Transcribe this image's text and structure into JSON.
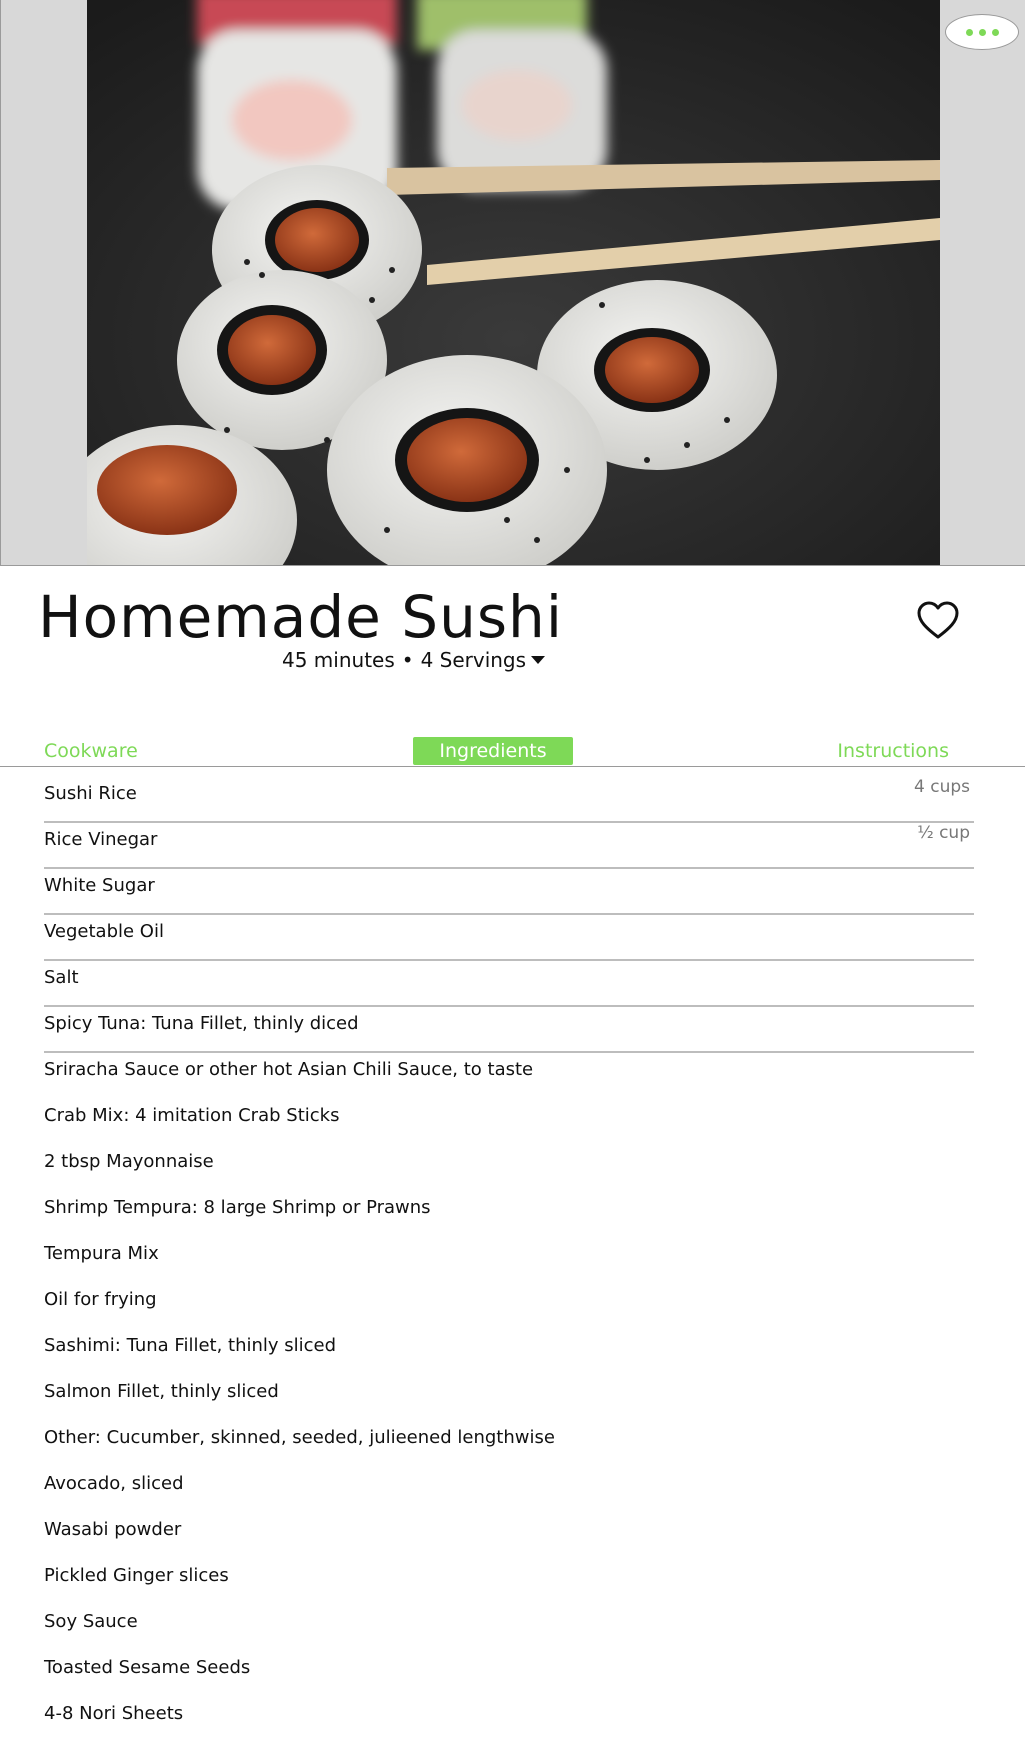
{
  "recipe": {
    "title": "Homemade Sushi",
    "time": "45 minutes",
    "separator": "•",
    "servings": "4 Servings"
  },
  "icons": {
    "more": "more-dots-icon",
    "favorite": "heart-outline-icon",
    "dropdown": "caret-down-icon"
  },
  "colors": {
    "accent": "#7ed957",
    "text": "#111111",
    "muted": "#777777",
    "rule": "#bdbdbd"
  },
  "tabs": [
    {
      "label": "Cookware",
      "active": false
    },
    {
      "label": "Ingredients",
      "active": true
    },
    {
      "label": "Instructions",
      "active": false
    }
  ],
  "ingredients": [
    {
      "name": "Sushi Rice",
      "qty": "4 cups",
      "divider": true
    },
    {
      "name": "Rice Vinegar",
      "qty": "½ cup",
      "divider": true
    },
    {
      "name": "White Sugar",
      "qty": "",
      "divider": true
    },
    {
      "name": "Vegetable Oil",
      "qty": "",
      "divider": true
    },
    {
      "name": "Salt",
      "qty": "",
      "divider": true
    },
    {
      "name": "Spicy Tuna: Tuna Fillet, thinly diced",
      "qty": "",
      "divider": true
    },
    {
      "name": "Sriracha Sauce or other hot Asian Chili Sauce, to taste",
      "qty": "",
      "divider": false
    },
    {
      "name": "Crab Mix: 4 imitation Crab Sticks",
      "qty": "",
      "divider": false
    },
    {
      "name": "2 tbsp Mayonnaise",
      "qty": "",
      "divider": false
    },
    {
      "name": "Shrimp Tempura: 8 large Shrimp or Prawns",
      "qty": "",
      "divider": false
    },
    {
      "name": "Tempura Mix",
      "qty": "",
      "divider": false
    },
    {
      "name": "Oil for frying",
      "qty": "",
      "divider": false
    },
    {
      "name": "Sashimi: Tuna Fillet, thinly sliced",
      "qty": "",
      "divider": false
    },
    {
      "name": "Salmon Fillet, thinly sliced",
      "qty": "",
      "divider": false
    },
    {
      "name": "Other: Cucumber, skinned, seeded, julieened lengthwise",
      "qty": "",
      "divider": false
    },
    {
      "name": "Avocado, sliced",
      "qty": "",
      "divider": false
    },
    {
      "name": "Wasabi powder",
      "qty": "",
      "divider": false
    },
    {
      "name": "Pickled Ginger slices",
      "qty": "",
      "divider": false
    },
    {
      "name": "Soy Sauce",
      "qty": "",
      "divider": false
    },
    {
      "name": "Toasted Sesame Seeds",
      "qty": "",
      "divider": false
    },
    {
      "name": "4-8 Nori Sheets",
      "qty": "",
      "divider": false
    }
  ]
}
